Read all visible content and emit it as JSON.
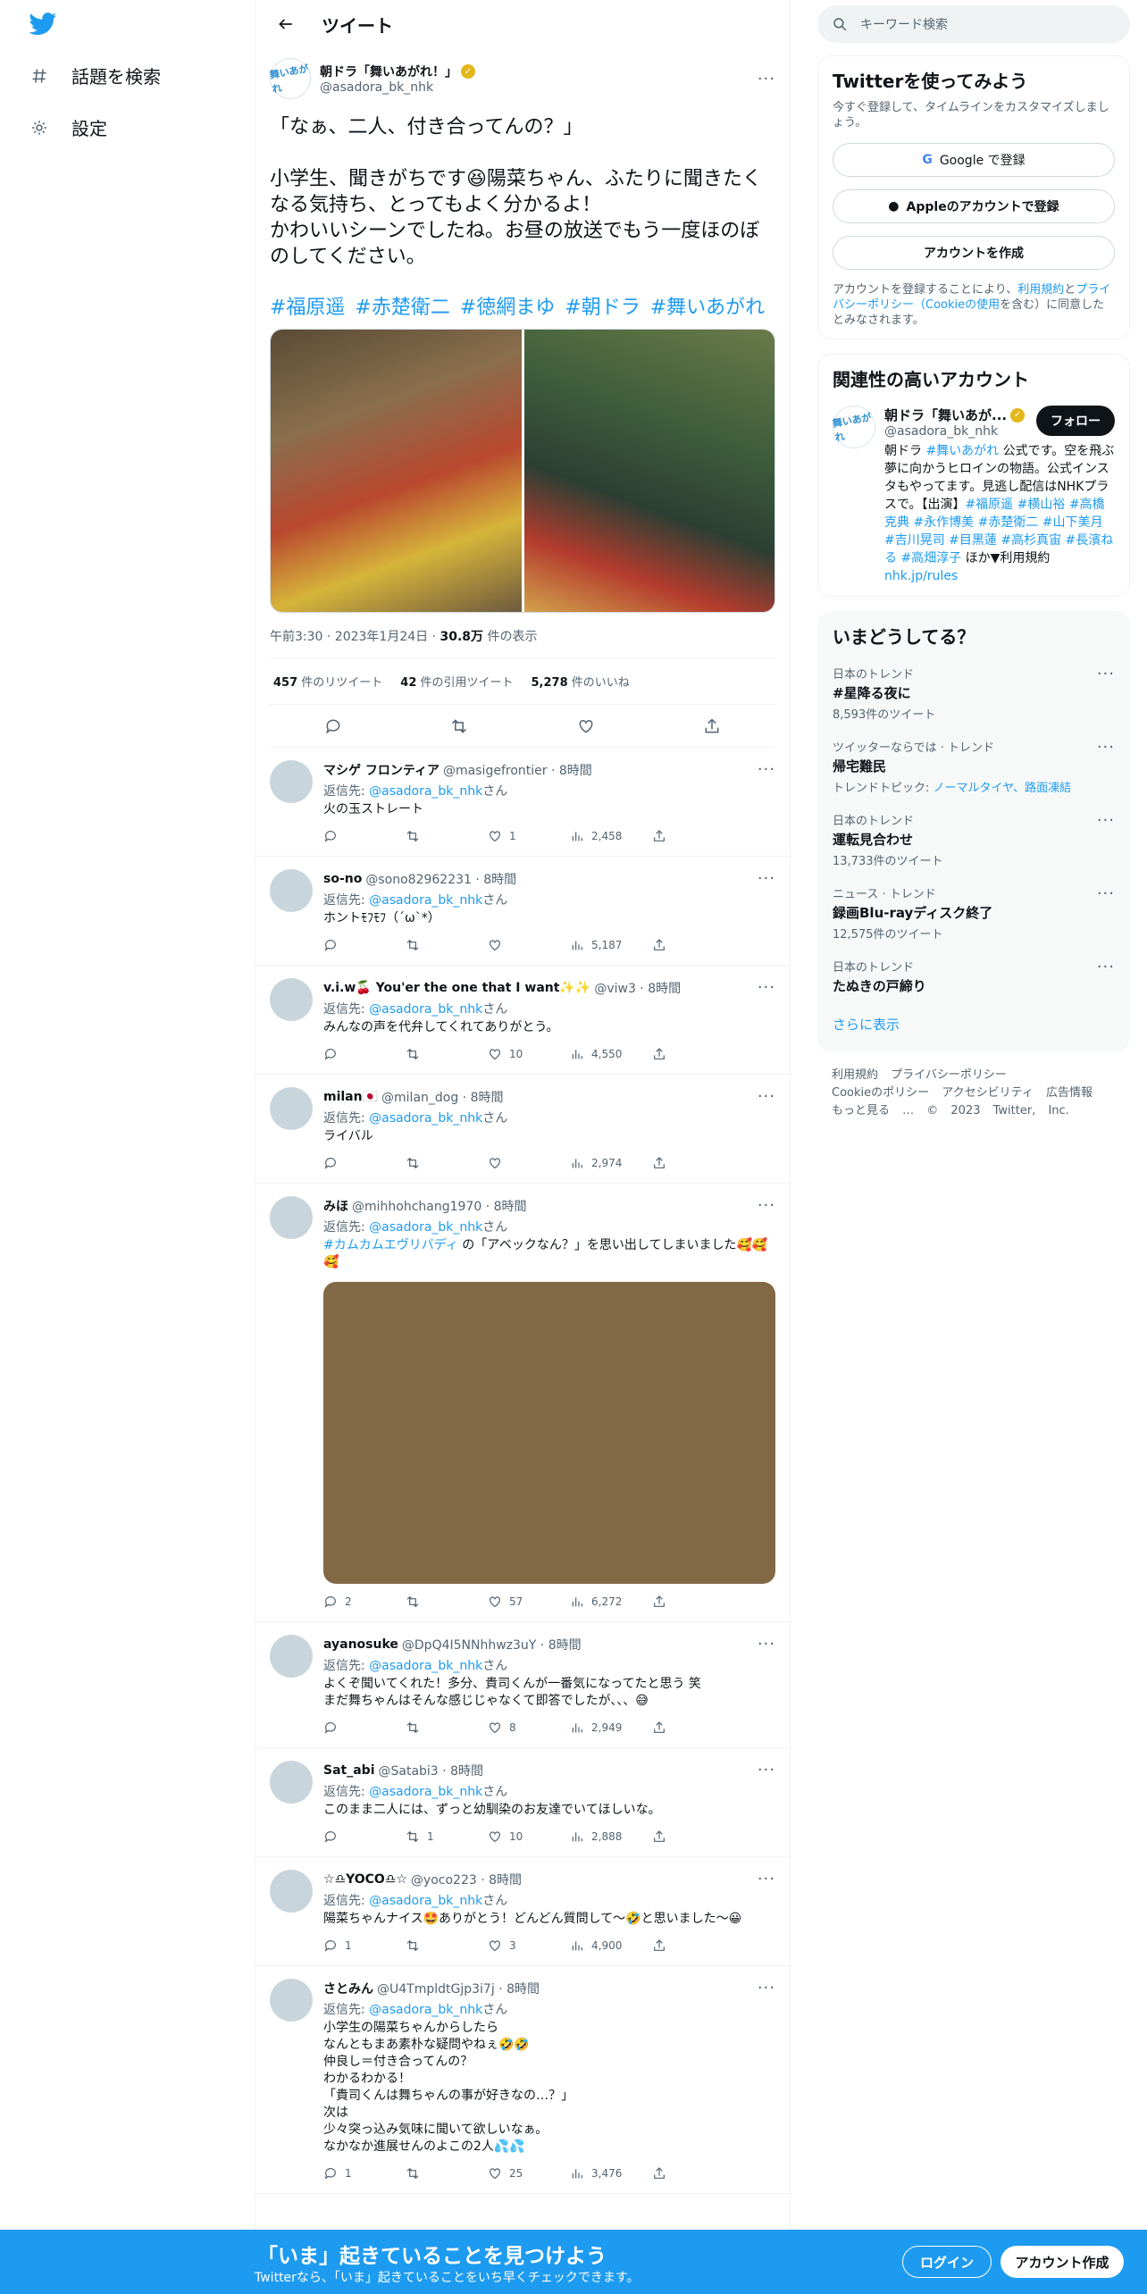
{
  "nav": {
    "explore": "話題を検索",
    "settings": "設定"
  },
  "header": {
    "title": "ツイート"
  },
  "tweet": {
    "name": "朝ドラ「舞いあがれ！」",
    "handle": "@asadora_bk_nhk",
    "avatar_text": "舞いあがれ",
    "text": "「なぁ、二人、付き合ってんの？」\n\n小学生、聞きがちです😆陽菜ちゃん、ふたりに聞きたくなる気持ち、とってもよく分かるよ！\nかわいいシーンでしたね。お昼の放送でもう一度ほのぼのしてください。",
    "hashtags": "#福原遥 #赤楚衛二 #徳網まゆ #朝ドラ #舞いあがれ",
    "time": "午前3:30 · 2023年1月24日 · ",
    "views": "30.8万",
    "views_label": " 件の表示",
    "retweets": "457",
    "retweets_label": " 件のリツイート",
    "quotes": "42",
    "quotes_label": " 件の引用ツイート",
    "likes": "5,278",
    "likes_label": " 件のいいね"
  },
  "replies": [
    {
      "name": "マシゲ フロンティア",
      "handle": "@masigefrontier · 8時間",
      "to_prefix": "返信先: ",
      "to": "@asadora_bk_nhk",
      "to_suffix": "さん",
      "text": "火の玉ストレート",
      "replies": "",
      "retweets": "",
      "likes": "1",
      "views": "2,458"
    },
    {
      "name": "so-no",
      "handle": "@sono82962231 · 8時間",
      "to_prefix": "返信先: ",
      "to": "@asadora_bk_nhk",
      "to_suffix": "さん",
      "text": "ホントﾓﾌﾓﾌ（´ω`*）",
      "replies": "",
      "retweets": "",
      "likes": "",
      "views": "5,187"
    },
    {
      "name": "v.i.w🍒 You'er the one that I want✨✨",
      "handle": "@viw3 · 8時間",
      "to_prefix": "返信先: ",
      "to": "@asadora_bk_nhk",
      "to_suffix": "さん",
      "text": "みんなの声を代弁してくれてありがとう。",
      "replies": "",
      "retweets": "",
      "likes": "10",
      "views": "4,550"
    },
    {
      "name": "milan🇯🇵",
      "handle": "@milan_dog · 8時間",
      "to_prefix": "返信先: ",
      "to": "@asadora_bk_nhk",
      "to_suffix": "さん",
      "text": "ライバル",
      "replies": "",
      "retweets": "",
      "likes": "",
      "views": "2,974"
    },
    {
      "name": "みほ",
      "handle": "@mihhohchang1970 · 8時間",
      "to_prefix": "返信先: ",
      "to": "@asadora_bk_nhk",
      "to_suffix": "さん",
      "text_link": "#カムカムエヴリバディ",
      "text": " の「アベックなん？」を思い出してしまいました🥰🥰🥰",
      "replies": "2",
      "retweets": "",
      "likes": "57",
      "views": "6,272",
      "has_media": true
    },
    {
      "name": "ayanosuke",
      "handle": "@DpQ4I5NNhhwz3uY · 8時間",
      "to_prefix": "返信先: ",
      "to": "@asadora_bk_nhk",
      "to_suffix": "さん",
      "text": "よくぞ聞いてくれた！多分、貴司くんが一番気になってたと思う 笑\nまだ舞ちゃんはそんな感じじゃなくて即答でしたが、、、😅",
      "replies": "",
      "retweets": "",
      "likes": "8",
      "views": "2,949"
    },
    {
      "name": "Sat_abi",
      "handle": "@Satabi3 · 8時間",
      "to_prefix": "返信先: ",
      "to": "@asadora_bk_nhk",
      "to_suffix": "さん",
      "text": "このまま二人には、ずっと幼馴染のお友達でいてほしいな。",
      "replies": "",
      "retweets": "1",
      "likes": "10",
      "views": "2,888"
    },
    {
      "name": "☆♎YOCO♎☆",
      "handle": "@yoco223 · 8時間",
      "to_prefix": "返信先: ",
      "to": "@asadora_bk_nhk",
      "to_suffix": "さん",
      "text": "陽菜ちゃんナイス🤩ありがとう！どんどん質問して〜🤣と思いました〜😀",
      "replies": "1",
      "retweets": "",
      "likes": "3",
      "views": "4,900"
    },
    {
      "name": "さとみん",
      "handle": "@U4TmpldtGjp3i7j · 8時間",
      "to_prefix": "返信先: ",
      "to": "@asadora_bk_nhk",
      "to_suffix": "さん",
      "text": "小学生の陽菜ちゃんからしたら\nなんともまあ素朴な疑問やねぇ🤣🤣\n仲良し＝付き合ってんの？\nわかるわかる！\n「貴司くんは舞ちゃんの事が好きなの…？」\n次は\n少々突っ込み気味に聞いて欲しいなぁ。\nなかなか進展せんのよこの2人💦💦",
      "replies": "1",
      "retweets": "",
      "likes": "25",
      "views": "3,476"
    }
  ],
  "search": {
    "placeholder": "キーワード検索"
  },
  "signup_card": {
    "title": "Twitterを使ってみよう",
    "sub": "今すぐ登録して、タイムラインをカスタマイズしましょう。",
    "google": "Google で登録",
    "apple": "Appleのアカウントで登録",
    "create": "アカウントを作成",
    "legal1": "アカウントを登録することにより、",
    "legal_terms": "利用規約",
    "legal2": "と",
    "legal_privacy": "プライバシーポリシー（Cookieの使用",
    "legal3": "を含む）に同意したとみなされます。"
  },
  "related": {
    "title": "関連性の高いアカウント",
    "name": "朝ドラ「舞いあが...",
    "handle": "@asadora_bk_nhk",
    "follow": "フォロー",
    "bio1": "朝ドラ ",
    "bio_tag1": "#舞いあがれ",
    "bio2": " 公式です。空を飛ぶ夢に向かうヒロインの物語。公式インスタもやってます。見逃し配信はNHKプラスで。【出演】",
    "bio_tags": "#福原遥 #横山裕 #高橋克典 #永作博美 #赤楚衛二 #山下美月 #吉川晃司 #目黒蓮 #高杉真宙 #長濱ねる #高畑淳子",
    "bio3": " ほか▼利用規約 ",
    "bio_link": "nhk.jp/rules"
  },
  "trends": {
    "title": "いまどうしてる？",
    "items": [
      {
        "cat": "日本のトレンド",
        "name": "#星降る夜に",
        "count": "8,593件のツイート"
      },
      {
        "cat": "ツイッターならでは · トレンド",
        "name": "帰宅難民",
        "count_prefix": "トレンドトピック: ",
        "count_link": "ノーマルタイヤ、路面凍結"
      },
      {
        "cat": "日本のトレンド",
        "name": "運転見合わせ",
        "count": "13,733件のツイート"
      },
      {
        "cat": "ニュース · トレンド",
        "name": "録画Blu-rayディスク終了",
        "count": "12,575件のツイート"
      },
      {
        "cat": "日本のトレンド",
        "name": "たぬきの戸締り",
        "count": ""
      }
    ],
    "more": "さらに表示"
  },
  "footer": {
    "l1": "利用規約 プライバシーポリシー",
    "l2": "Cookieのポリシー アクセシビリティ 広告情報",
    "l3": "もっと見る … © 2023 Twitter, Inc."
  },
  "bottom": {
    "title": "「いま」起きていることを見つけよう",
    "sub": "Twitterなら、「いま」起きていることをいち早くチェックできます。",
    "login": "ログイン",
    "signup": "アカウント作成"
  },
  "colors": {
    "accent": "#1d9bf0",
    "text": "#0f1419",
    "muted": "#536471"
  }
}
